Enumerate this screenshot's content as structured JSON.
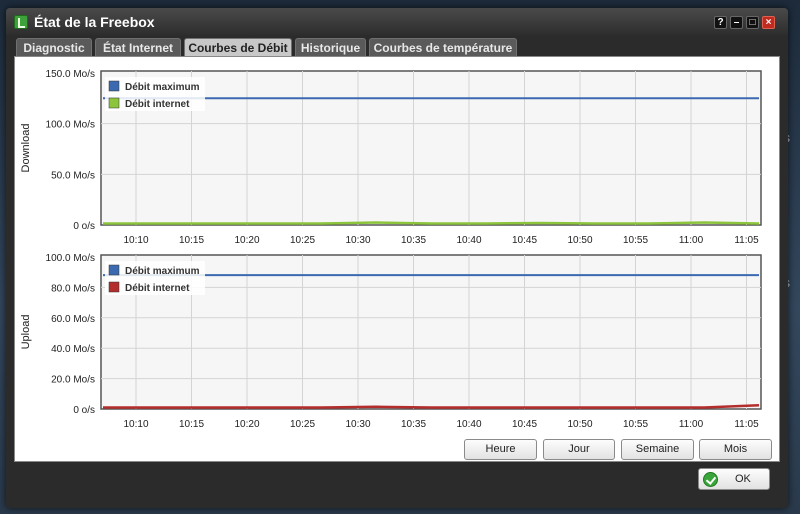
{
  "window": {
    "title": "État de la Freebox"
  },
  "window_controls": [
    "?",
    "–",
    "□",
    "×"
  ],
  "background_text": {
    "letter": "s"
  },
  "tabs": [
    {
      "label": "Diagnostic",
      "active": false
    },
    {
      "label": "État Internet",
      "active": false
    },
    {
      "label": "Courbes de Débit",
      "active": true
    },
    {
      "label": "Historique",
      "active": false
    },
    {
      "label": "Courbes de température",
      "active": false
    }
  ],
  "colors": {
    "max_line": "#3b6ab0",
    "download_series": "#8cc43c",
    "upload_series": "#b32d2d",
    "grid": "#d4d4d4",
    "plot_bg": "#f6f6f6"
  },
  "chart_data": [
    {
      "type": "line",
      "ylabel": "Download",
      "y_ticks": [
        "150.0 Mo/s",
        "100.0 Mo/s",
        "50.0 Mo/s",
        "0 o/s"
      ],
      "ylim": [
        0,
        150
      ],
      "x_ticks": [
        "10:10",
        "10:15",
        "10:20",
        "10:25",
        "10:30",
        "10:35",
        "10:40",
        "10:45",
        "10:50",
        "10:55",
        "11:00",
        "11:05"
      ],
      "legend": [
        "Débit maximum",
        "Débit internet"
      ],
      "legend_position": "top-left",
      "grid": true,
      "series": [
        {
          "name": "Débit maximum",
          "color": "#3b6ab0",
          "values": [
            125,
            125,
            125,
            125,
            125,
            125,
            125,
            125,
            125,
            125,
            125,
            125,
            125
          ]
        },
        {
          "name": "Débit internet",
          "color": "#8cc43c",
          "values": [
            0.5,
            0.5,
            0.5,
            0.5,
            0.5,
            1.5,
            0.5,
            0.5,
            1,
            0.5,
            0.5,
            1.5,
            0.5
          ]
        }
      ]
    },
    {
      "type": "line",
      "ylabel": "Upload",
      "y_ticks": [
        "100.0 Mo/s",
        "80.0 Mo/s",
        "60.0 Mo/s",
        "40.0 Mo/s",
        "20.0 Mo/s",
        "0 o/s"
      ],
      "ylim": [
        0,
        100
      ],
      "x_ticks": [
        "10:10",
        "10:15",
        "10:20",
        "10:25",
        "10:30",
        "10:35",
        "10:40",
        "10:45",
        "10:50",
        "10:55",
        "11:00",
        "11:05"
      ],
      "legend": [
        "Débit maximum",
        "Débit internet"
      ],
      "legend_position": "top-left",
      "grid": true,
      "series": [
        {
          "name": "Débit maximum",
          "color": "#3b6ab0",
          "values": [
            88,
            88,
            88,
            88,
            88,
            88,
            88,
            88,
            88,
            88,
            88,
            88,
            88
          ]
        },
        {
          "name": "Débit internet",
          "color": "#b32d2d",
          "values": [
            0.3,
            0.3,
            0.3,
            0.3,
            0.3,
            0.8,
            0.3,
            0.3,
            0.3,
            0.3,
            0.3,
            0.3,
            1.8
          ]
        }
      ]
    }
  ],
  "range_buttons": [
    "Heure",
    "Jour",
    "Semaine",
    "Mois"
  ],
  "footer": {
    "ok_label": "OK"
  }
}
